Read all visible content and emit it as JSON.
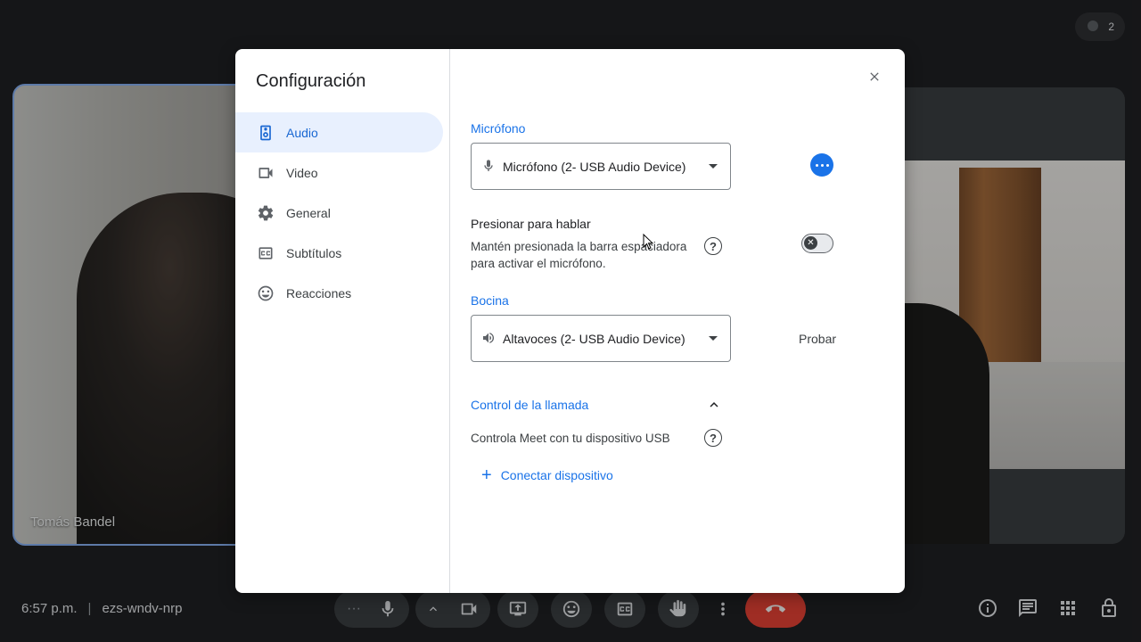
{
  "call": {
    "left_participant_name": "Tomás Bandel",
    "participants_count": "2",
    "time": "6:57 p.m.",
    "meeting_code": "ezs-wndv-nrp"
  },
  "dialog": {
    "title": "Configuración",
    "nav": [
      {
        "label": "Audio",
        "icon": "speaker-icon",
        "active": true
      },
      {
        "label": "Video",
        "icon": "camera-icon"
      },
      {
        "label": "General",
        "icon": "gear-icon"
      },
      {
        "label": "Subtítulos",
        "icon": "captions-icon"
      },
      {
        "label": "Reacciones",
        "icon": "smiley-icon"
      }
    ],
    "audio": {
      "mic_label": "Micrófono",
      "mic_value": "Micrófono (2- USB Audio Device)",
      "ptt_title": "Presionar para hablar",
      "ptt_desc": "Mantén presionada la barra espaciadora para activar el micrófono.",
      "ptt_enabled": false,
      "speaker_label": "Bocina",
      "speaker_value": "Altavoces (2- USB Audio Device)",
      "test_label": "Probar",
      "call_control_label": "Control de la llamada",
      "call_control_desc": "Controla Meet con tu dispositivo USB",
      "connect_label": "Conectar dispositivo"
    }
  },
  "colors": {
    "accent": "#1a73e8",
    "active_nav_bg": "#e8f0fe",
    "end_call": "#ea4335"
  }
}
